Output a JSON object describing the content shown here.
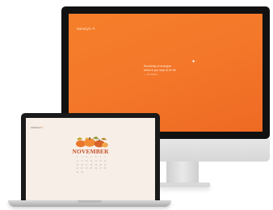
{
  "imac": {
    "logo_text": "saranyn",
    "logo_mark": "✧",
    "quote_line_1": "Electricity of energies",
    "quote_line_2": "when it you stop to be fill.",
    "quote_author": "— Jim Rohn"
  },
  "laptop": {
    "logo_text": "saranyn",
    "logo_mark": "✧",
    "month": "NOVEMBER",
    "days": [
      "1",
      "2",
      "3",
      "4",
      "5",
      "6",
      "7",
      "8",
      "9",
      "10",
      "11",
      "12",
      "13",
      "14",
      "15",
      "16",
      "17",
      "18",
      "19",
      "20",
      "21",
      "22",
      "23",
      "24",
      "25",
      "26",
      "27",
      "28",
      "29",
      "30"
    ]
  },
  "colors": {
    "desktop_wallpaper": "#f57f2a",
    "laptop_wallpaper": "#f7efe7",
    "month_text": "#c74f2a"
  }
}
